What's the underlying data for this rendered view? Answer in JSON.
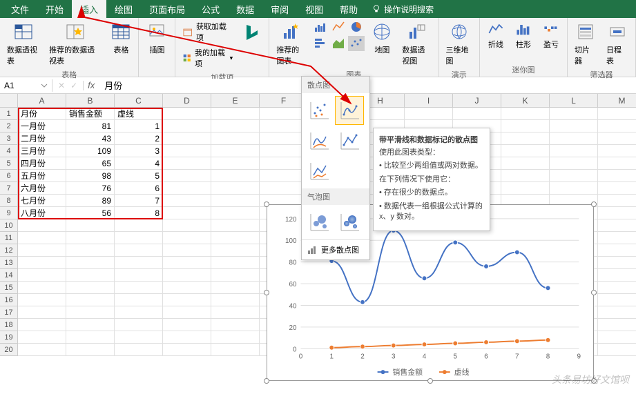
{
  "tabs": {
    "file": "文件",
    "home": "开始",
    "insert": "插入",
    "draw": "绘图",
    "layout": "页面布局",
    "formula": "公式",
    "data": "数据",
    "review": "审阅",
    "view": "视图",
    "help": "帮助",
    "search": "操作说明搜索"
  },
  "ribbon": {
    "pivot": "数据透视表",
    "recpivot": "推荐的数据透视表",
    "tables_label": "表格",
    "table": "表格",
    "illust": "插图",
    "getaddin": "获取加载项",
    "myaddin": "我的加载项",
    "addins_label": "加载项",
    "recchart": "推荐的图表",
    "charts_label": "图表",
    "map": "地图",
    "pivotchart": "数据透视图",
    "map3d": "三维地图",
    "tours_label": "演示",
    "sparkline_line": "折线",
    "sparkline_col": "柱形",
    "sparkline_wl": "盈亏",
    "spark_label": "迷你图",
    "slicer": "切片器",
    "timeline": "日程表",
    "filter_label": "筛选器"
  },
  "formula_bar": {
    "namebox": "A1",
    "value": "月份"
  },
  "columns": [
    "A",
    "B",
    "C",
    "D",
    "E",
    "F",
    "G",
    "H",
    "I",
    "J",
    "K",
    "L",
    "M"
  ],
  "rows_count": 20,
  "table": {
    "headers": [
      "月份",
      "销售金额",
      "虚线"
    ],
    "rows": [
      [
        "一月份",
        "81",
        "1"
      ],
      [
        "二月份",
        "43",
        "2"
      ],
      [
        "三月份",
        "109",
        "3"
      ],
      [
        "四月份",
        "65",
        "4"
      ],
      [
        "五月份",
        "98",
        "5"
      ],
      [
        "六月份",
        "76",
        "6"
      ],
      [
        "七月份",
        "89",
        "7"
      ],
      [
        "八月份",
        "56",
        "8"
      ]
    ]
  },
  "scatter_popup": {
    "sec1": "散点图",
    "sec2": "气泡图",
    "more": "更多散点图"
  },
  "tooltip": {
    "title": "带平滑线和数据标记的散点图",
    "line1": "使用此图表类型：",
    "line2": "• 比较至少两组值或两对数据。",
    "line3": "在下列情况下使用它：",
    "line4": "• 存在很少的数据点。",
    "line5": "• 数据代表一组根据公式计算的 x、y 数对。"
  },
  "chart_data": {
    "type": "line",
    "x": [
      1,
      2,
      3,
      4,
      5,
      6,
      7,
      8
    ],
    "series": [
      {
        "name": "销售金额",
        "values": [
          81,
          43,
          109,
          65,
          98,
          76,
          89,
          56
        ],
        "color": "#4472c4"
      },
      {
        "name": "虚线",
        "values": [
          1,
          2,
          3,
          4,
          5,
          6,
          7,
          8
        ],
        "color": "#ed7d31"
      }
    ],
    "xlim": [
      0,
      9
    ],
    "ylim": [
      0,
      120
    ],
    "yticks": [
      0,
      20,
      40,
      60,
      80,
      100,
      120
    ],
    "xticks": [
      0,
      1,
      2,
      3,
      4,
      5,
      6,
      7,
      8,
      9
    ],
    "legend": [
      "销售金额",
      "虚线"
    ]
  },
  "watermark": "头条易坊好文馆呗"
}
